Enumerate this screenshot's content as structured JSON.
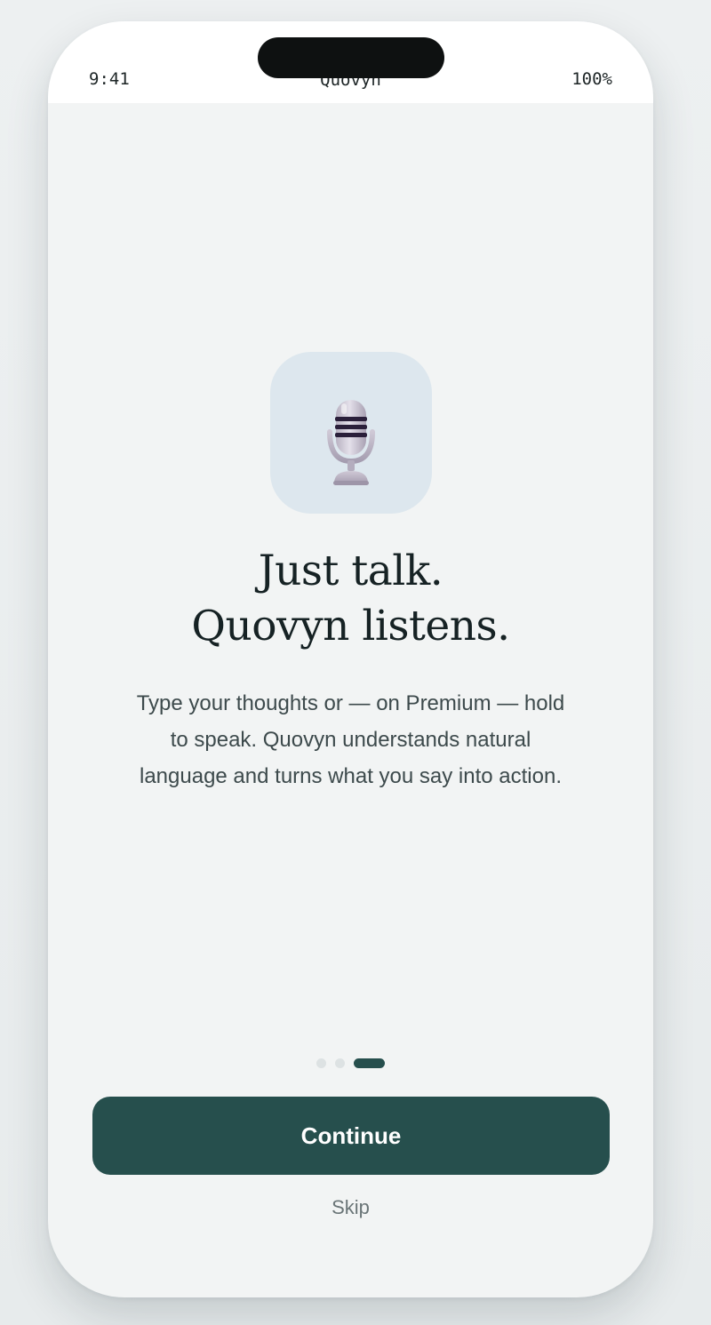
{
  "status_bar": {
    "time": "9:41",
    "title": "Quovyn",
    "battery": "100%"
  },
  "hero": {
    "icon": "microphone-icon",
    "headline_line1": "Just talk.",
    "headline_line2": "Quovyn listens.",
    "body": "Type your thoughts or — on Premium — hold to speak. Quovyn understands natural language and turns what you say into action."
  },
  "pager": {
    "total": 3,
    "active_index": 2
  },
  "actions": {
    "continue_label": "Continue",
    "skip_label": "Skip"
  },
  "colors": {
    "accent": "#264f4d",
    "tile": "#dde7ee",
    "background": "#f2f4f4"
  }
}
